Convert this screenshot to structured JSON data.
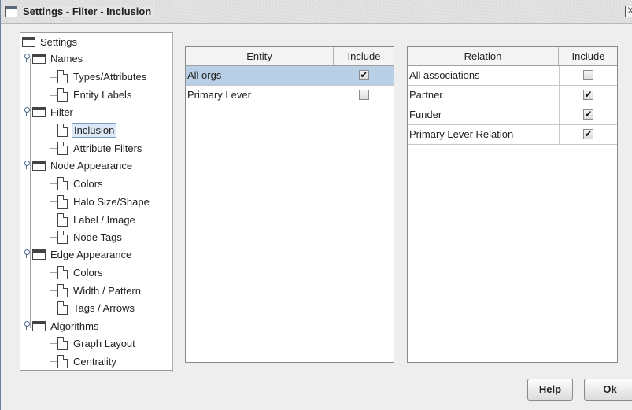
{
  "window": {
    "title": "Settings - Filter - Inclusion",
    "close_glyph": "X"
  },
  "tree": {
    "root": "Settings",
    "names": {
      "label": "Names",
      "types_attributes": "Types/Attributes",
      "entity_labels": "Entity Labels"
    },
    "filter": {
      "label": "Filter",
      "inclusion": "Inclusion",
      "attribute_filters": "Attribute Filters"
    },
    "node_appearance": {
      "label": "Node Appearance",
      "colors": "Colors",
      "halo": "Halo Size/Shape",
      "label_image": "Label / Image",
      "node_tags": "Node Tags"
    },
    "edge_appearance": {
      "label": "Edge Appearance",
      "colors": "Colors",
      "width_pattern": "Width / Pattern",
      "tags_arrows": "Tags / Arrows"
    },
    "algorithms": {
      "label": "Algorithms",
      "graph_layout": "Graph Layout",
      "centrality": "Centrality"
    },
    "selected": "Inclusion"
  },
  "entity_table": {
    "headers": [
      "Entity",
      "Include"
    ],
    "rows": [
      {
        "name": "All orgs",
        "include": true,
        "selected": true
      },
      {
        "name": "Primary Lever",
        "include": false,
        "selected": false
      }
    ]
  },
  "relation_table": {
    "headers": [
      "Relation",
      "Include"
    ],
    "rows": [
      {
        "name": "All associations",
        "include": false
      },
      {
        "name": "Partner",
        "include": true
      },
      {
        "name": "Funder",
        "include": true
      },
      {
        "name": "Primary Lever Relation",
        "include": true
      }
    ]
  },
  "buttons": {
    "help": "Help",
    "ok": "Ok"
  },
  "check_glyph": "✔"
}
